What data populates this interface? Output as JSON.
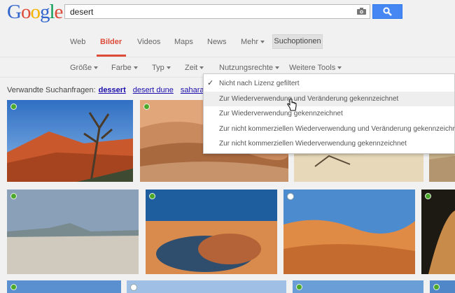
{
  "logo": {
    "letters": [
      {
        "ch": "G",
        "color": "#3366cc"
      },
      {
        "ch": "o",
        "color": "#dd4b39"
      },
      {
        "ch": "o",
        "color": "#f4b400"
      },
      {
        "ch": "g",
        "color": "#3366cc"
      },
      {
        "ch": "l",
        "color": "#0f9d58"
      },
      {
        "ch": "e",
        "color": "#dd4b39"
      }
    ]
  },
  "search": {
    "value": "desert"
  },
  "nav": {
    "web": "Web",
    "bilder": "Bilder",
    "videos": "Videos",
    "maps": "Maps",
    "news": "News",
    "mehr": "Mehr",
    "suchoptionen": "Suchoptionen"
  },
  "tools": {
    "groesse": "Größe",
    "farbe": "Farbe",
    "typ": "Typ",
    "zeit": "Zeit",
    "nutzungsrechte": "Nutzungsrechte",
    "weitere": "Weitere Tools"
  },
  "related": {
    "label": "Verwandte Suchanfragen:",
    "links": [
      "dessert",
      "desert dune",
      "sahara des"
    ]
  },
  "menu": {
    "items": [
      "Nicht nach Lizenz gefiltert",
      "Zur Wiederverwendung und Veränderung gekennzeichnet",
      "Zur Wiederverwendung gekennzeichnet",
      "Zur nicht kommerziellen Wiederverwendung und Veränderung gekennzeichnet",
      "Zur nicht kommerziellen Wiederverwendung gekennzeichnet"
    ],
    "checked_index": 0,
    "hover_index": 1
  }
}
